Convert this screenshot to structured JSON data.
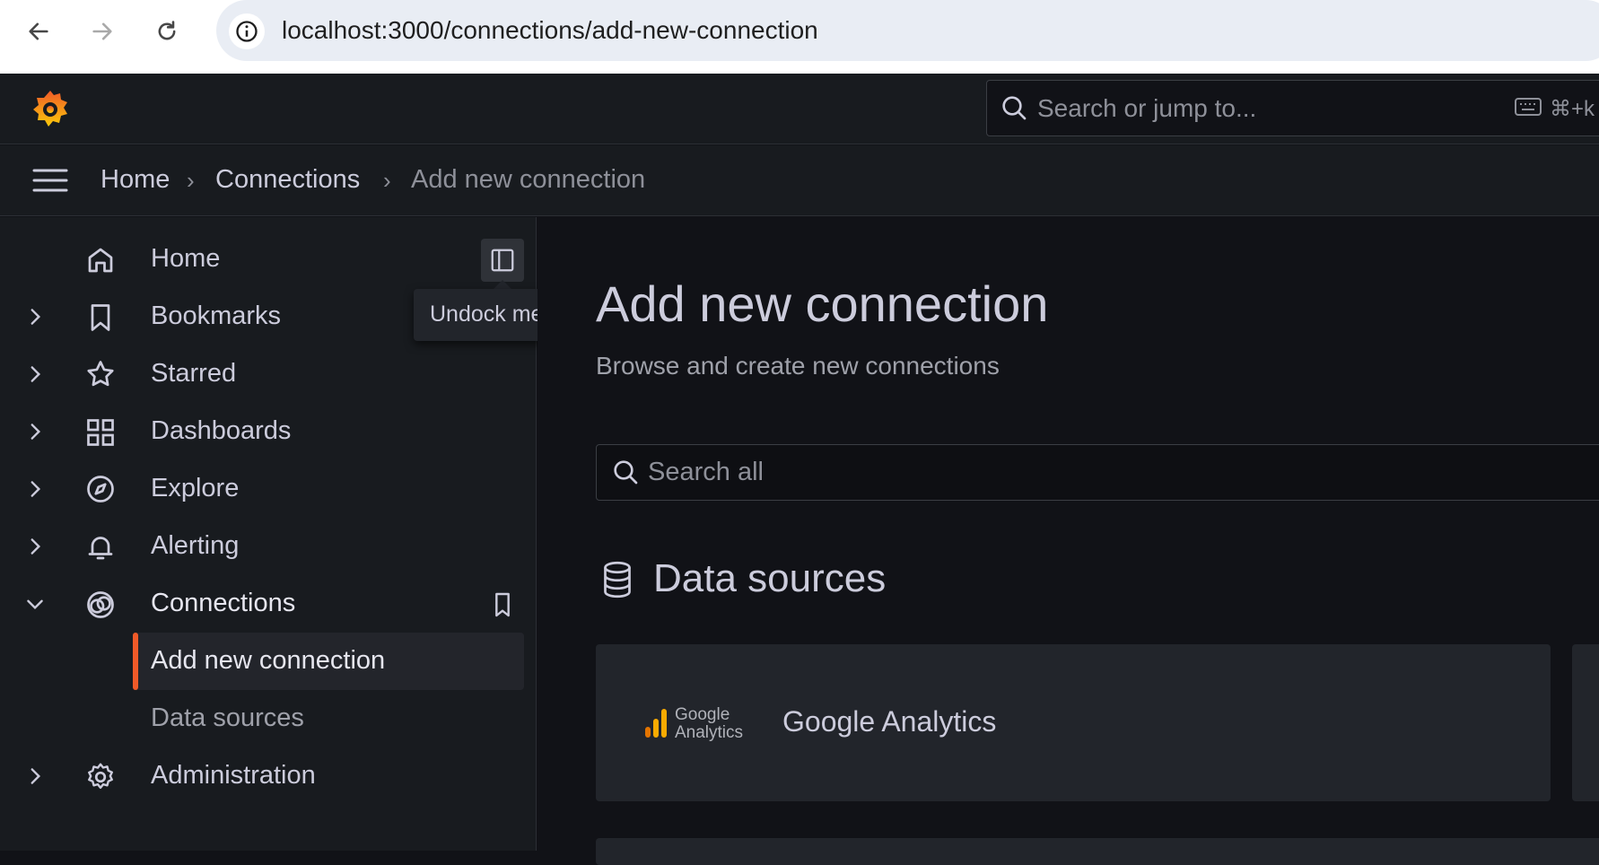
{
  "browser": {
    "url": "localhost:3000/connections/add-new-connection",
    "icons": [
      "back-arrow-icon",
      "forward-arrow-icon",
      "reload-icon",
      "site-info-icon"
    ]
  },
  "topbar": {
    "search_placeholder": "Search or jump to...",
    "shortcut": "⌘+k",
    "brand_color": "#f05a28"
  },
  "breadcrumb": {
    "items": [
      "Home",
      "Connections",
      "Add new connection"
    ]
  },
  "sidebar": {
    "items": [
      {
        "label": "Home",
        "icon": "home-icon"
      },
      {
        "label": "Bookmarks",
        "icon": "bookmark-icon"
      },
      {
        "label": "Starred",
        "icon": "star-icon"
      },
      {
        "label": "Dashboards",
        "icon": "grid-icon"
      },
      {
        "label": "Explore",
        "icon": "compass-icon"
      },
      {
        "label": "Alerting",
        "icon": "bell-icon"
      },
      {
        "label": "Connections",
        "icon": "connections-icon"
      },
      {
        "label": "Add new connection"
      },
      {
        "label": "Data sources"
      },
      {
        "label": "Administration",
        "icon": "gear-icon"
      }
    ],
    "tooltip": "Undock menu",
    "active_color": "#f05a28"
  },
  "main": {
    "title": "Add new connection",
    "subtitle": "Browse and create new connections",
    "search_placeholder": "Search all",
    "section_title": "Data sources",
    "cards": [
      {
        "title": "Google Analytics",
        "logo_line1": "Google",
        "logo_line2": "Analytics"
      }
    ]
  }
}
